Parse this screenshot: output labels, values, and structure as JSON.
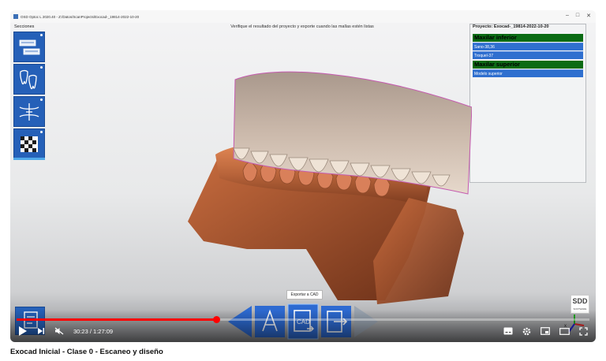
{
  "window": {
    "title": "OSD Optoc L 2020.40 - Z:/Datos/ScanProjects/Exocad-_19814-2022-10-20",
    "controls": [
      "–",
      "□",
      "✕"
    ]
  },
  "sidebar": {
    "label": "Secciones",
    "sections": [
      {
        "icon": "scan-arches-icon"
      },
      {
        "icon": "teeth-icon"
      },
      {
        "icon": "articulator-icon"
      },
      {
        "icon": "finish-flag-icon"
      }
    ]
  },
  "hint_text": "Verifique el resultado del proyecto y exporte cuando las mallas estén listas",
  "project": {
    "title": "Proyecto: Exocad-_19814-2022-10-20",
    "groups": [
      {
        "name": "Maxilar inferior",
        "items": [
          "Sano-38,36",
          "Troquel-37"
        ]
      },
      {
        "name": "Maxilar superior",
        "items": [
          "Modelo superior"
        ]
      }
    ]
  },
  "toolbar": {
    "export_label": "Exportar a CAD",
    "buttons": [
      {
        "icon": "cad-measure-icon"
      },
      {
        "icon": "export-cad-icon"
      },
      {
        "icon": "export-file-icon"
      }
    ]
  },
  "logo": {
    "text": "SDD",
    "subtext": "SOFTWARE"
  },
  "player": {
    "time": "30:23 / 1:27:09",
    "progress": 0.348,
    "accent": "#ff0000",
    "left_controls": [
      "play-icon",
      "next-icon",
      "mute-icon"
    ],
    "right_controls": [
      "subtitles-icon",
      "settings-icon",
      "miniplayer-icon",
      "theater-icon",
      "fullscreen-icon"
    ]
  },
  "video_title": "Exocad Inicial - Clase 0 - Escaneo y diseño"
}
